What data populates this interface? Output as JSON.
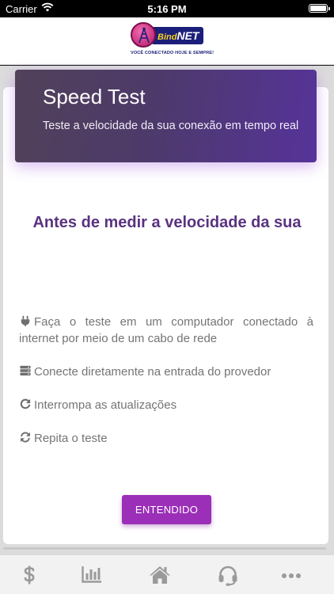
{
  "status_bar": {
    "carrier": "Carrier",
    "time": "5:16 PM"
  },
  "header": {
    "logo": {
      "brand_prefix": "Bind",
      "brand_name": "NET",
      "tagline": "VOCÊ CONECTADO HOJE E SEMPRE!"
    }
  },
  "hero": {
    "title": "Speed Test",
    "subtitle": "Teste a velocidade da sua conexão em tempo real"
  },
  "intro": {
    "heading": "Antes de medir a velocidade da sua"
  },
  "tips": [
    {
      "icon": "plug-icon",
      "text": "Faça o teste em um computador conectado à internet por meio de um cabo de rede"
    },
    {
      "icon": "server-icon",
      "text": "Conecte diretamente na entrada do provedor"
    },
    {
      "icon": "redo-icon",
      "text": "Interrompa as atualizações"
    },
    {
      "icon": "sync-icon",
      "text": "Repita o teste"
    }
  ],
  "confirm_button": {
    "label": "ENTENDIDO"
  },
  "tab_bar": {
    "items": [
      {
        "icon": "dollar-icon"
      },
      {
        "icon": "bar-chart-icon"
      },
      {
        "icon": "home-icon"
      },
      {
        "icon": "headset-icon"
      },
      {
        "icon": "more-icon"
      }
    ]
  },
  "colors": {
    "accent": "#9b2fb8",
    "heading": "#5a3380",
    "hero_start": "#514159",
    "hero_end": "#56339a",
    "tab_icon": "#9a9a9a"
  }
}
